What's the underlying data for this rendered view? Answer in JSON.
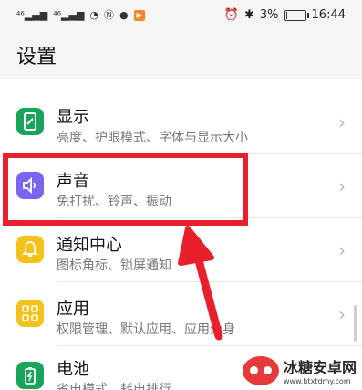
{
  "status_bar": {
    "signal_left": "ᐧıl",
    "signal_right": "ᐧıl",
    "time": "16:44",
    "battery_percent": "3%",
    "battery_level": 0.03
  },
  "page": {
    "title": "设置"
  },
  "rows": [
    {
      "title": "",
      "subtitle": ""
    },
    {
      "title": "显示",
      "subtitle": "亮度、护眼模式、字体与显示大小",
      "icon_color": "#1aa35a"
    },
    {
      "title": "声音",
      "subtitle": "免打扰、铃声、振动",
      "icon_color": "#7a64f0"
    },
    {
      "title": "通知中心",
      "subtitle": "图标角标、锁屏通知",
      "icon_color": "#f5c21a"
    },
    {
      "title": "应用",
      "subtitle": "权限管理、默认应用、应用分身",
      "icon_color": "#f5c21a"
    },
    {
      "title": "电池",
      "subtitle": "省电模式、耗电排行",
      "icon_color": "#1aa35a"
    }
  ],
  "watermark": {
    "title": "冰糖安卓网",
    "url": "www.btxtdmy.com"
  },
  "colors": {
    "highlight": "#e8202b",
    "arrow": "#e8202b"
  }
}
